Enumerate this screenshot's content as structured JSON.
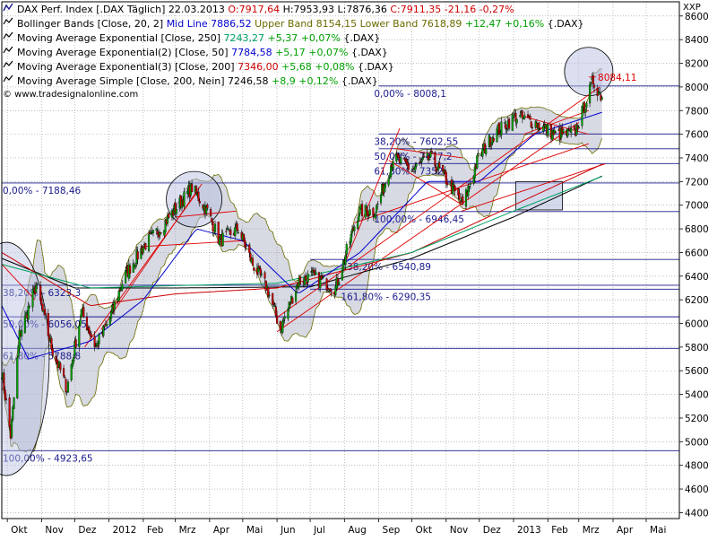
{
  "header": {
    "line1": {
      "instrument": "DAX Perf. Index [.DAX Täglich] 22.03.2013",
      "open": "O:7917,64",
      "high": "H:7953,93",
      "low": "L:7876,36",
      "close": "C:7911,35 -21,16 -0,27%"
    },
    "line2": {
      "prefix": "Bollinger Bands [Close, 20, 2]",
      "mid": "Mid Line 7886,52",
      "upper": "Upper Band 8154,15",
      "lower": "Lower Band 7618,89",
      "change": "+12,47 +0,16%",
      "suffix": "{.DAX}"
    },
    "line3": {
      "prefix": "Moving Average Exponential [Close, 250]",
      "value": "7243,27",
      "change": "+5,37 +0,07%",
      "suffix": "{.DAX}"
    },
    "line4": {
      "prefix": "Moving Average Exponential(2) [Close, 50]",
      "value": "7784,58",
      "change": "+5,17 +0,07%",
      "suffix": "{.DAX}"
    },
    "line5": {
      "prefix": "Moving Average Exponential(3) [Close, 200]",
      "value": "7346,00",
      "change": "+5,68 +0,08%",
      "suffix": "{.DAX}"
    },
    "line6": {
      "prefix": "Moving Average Simple [Close, 200, Nein]",
      "value": "7246,58",
      "change": "+8,9 +0,12%",
      "suffix": "{.DAX}"
    },
    "watermark": "© www.tradesignalonline.com"
  },
  "colors": {
    "upper_band": "#6b6b00",
    "lower_band": "#6b6b00",
    "ema250": "#00a060",
    "ema50": "#0000cc",
    "ema200": "#cc0000",
    "sma200": "#000000",
    "positive": "#00a000",
    "negative": "#cc0000",
    "fib_line": "#1a1a8c",
    "trend_line": "#e00000",
    "band_fill": "#c9ccda"
  },
  "chart_data": {
    "type": "candlestick",
    "axis_label": "XXP",
    "ylim": [
      4350,
      8720
    ],
    "y_ticks": [
      4400,
      4600,
      4800,
      5000,
      5200,
      5400,
      5600,
      5800,
      6000,
      6200,
      6400,
      6600,
      6800,
      7000,
      7200,
      7400,
      7600,
      7800,
      8000,
      8200,
      8400,
      8600
    ],
    "y_tick_labels": [
      "4400",
      "4600",
      "4800",
      "5000",
      "5200",
      "5400",
      "5600",
      "5800",
      "6000",
      "6200",
      "6400",
      "6600",
      "6800",
      "7000",
      "7200",
      "7400",
      "7600",
      "7800",
      "8000",
      "8200",
      "8400",
      "8600"
    ],
    "x_labels": [
      "Okt",
      "Nov",
      "Dez",
      "2012",
      "Feb",
      "Mrz",
      "Apr",
      "Mai",
      "Jun",
      "Jul",
      "Aug",
      "Sep",
      "Okt",
      "Nov",
      "Dez",
      "2013",
      "Feb",
      "Mrz",
      "Apr",
      "Mai"
    ],
    "x_range": [
      "2011-09-26",
      "2013-05-31"
    ],
    "x_label_dates": [
      "2011-10-01",
      "2011-11-01",
      "2011-12-01",
      "2012-01-01",
      "2012-02-01",
      "2012-03-01",
      "2012-04-01",
      "2012-05-01",
      "2012-06-01",
      "2012-07-01",
      "2012-08-01",
      "2012-09-01",
      "2012-10-01",
      "2012-11-01",
      "2012-12-01",
      "2013-01-01",
      "2013-02-01",
      "2013-03-01",
      "2013-04-01",
      "2013-05-01"
    ],
    "price_path": [
      {
        "date": "2011-09-26",
        "value": 5600
      },
      {
        "date": "2011-10-04",
        "value": 5050
      },
      {
        "date": "2011-10-12",
        "value": 5900
      },
      {
        "date": "2011-10-27",
        "value": 6320
      },
      {
        "date": "2011-11-10",
        "value": 5800
      },
      {
        "date": "2011-11-24",
        "value": 5450
      },
      {
        "date": "2011-12-07",
        "value": 6100
      },
      {
        "date": "2011-12-20",
        "value": 5800
      },
      {
        "date": "2012-01-02",
        "value": 6050
      },
      {
        "date": "2012-01-15",
        "value": 6400
      },
      {
        "date": "2012-02-01",
        "value": 6650
      },
      {
        "date": "2012-02-16",
        "value": 6800
      },
      {
        "date": "2012-03-16",
        "value": 7150
      },
      {
        "date": "2012-03-30",
        "value": 6950
      },
      {
        "date": "2012-04-10",
        "value": 6700
      },
      {
        "date": "2012-04-27",
        "value": 6800
      },
      {
        "date": "2012-05-10",
        "value": 6500
      },
      {
        "date": "2012-05-23",
        "value": 6300
      },
      {
        "date": "2012-06-04",
        "value": 5950
      },
      {
        "date": "2012-06-20",
        "value": 6350
      },
      {
        "date": "2012-07-02",
        "value": 6400
      },
      {
        "date": "2012-07-24",
        "value": 6300
      },
      {
        "date": "2012-08-14",
        "value": 6950
      },
      {
        "date": "2012-08-29",
        "value": 6950
      },
      {
        "date": "2012-09-14",
        "value": 7400
      },
      {
        "date": "2012-10-01",
        "value": 7300
      },
      {
        "date": "2012-10-18",
        "value": 7400
      },
      {
        "date": "2012-11-06",
        "value": 7150
      },
      {
        "date": "2012-11-16",
        "value": 7000
      },
      {
        "date": "2012-11-30",
        "value": 7400
      },
      {
        "date": "2012-12-14",
        "value": 7600
      },
      {
        "date": "2013-01-03",
        "value": 7750
      },
      {
        "date": "2013-01-20",
        "value": 7700
      },
      {
        "date": "2013-02-07",
        "value": 7600
      },
      {
        "date": "2013-02-25",
        "value": 7600
      },
      {
        "date": "2013-03-14",
        "value": 8050
      },
      {
        "date": "2013-03-22",
        "value": 7911
      }
    ],
    "sma200": [
      {
        "date": "2011-09-26",
        "value": 6550
      },
      {
        "date": "2011-12-01",
        "value": 6300
      },
      {
        "date": "2012-03-01",
        "value": 6300
      },
      {
        "date": "2012-07-01",
        "value": 6310
      },
      {
        "date": "2012-10-01",
        "value": 6550
      },
      {
        "date": "2013-01-01",
        "value": 6900
      },
      {
        "date": "2013-03-22",
        "value": 7247
      }
    ],
    "ema200": [
      {
        "date": "2011-09-26",
        "value": 6600
      },
      {
        "date": "2011-12-15",
        "value": 6150
      },
      {
        "date": "2012-03-01",
        "value": 6250
      },
      {
        "date": "2012-06-01",
        "value": 6300
      },
      {
        "date": "2012-10-01",
        "value": 6600
      },
      {
        "date": "2013-01-01",
        "value": 7000
      },
      {
        "date": "2013-03-22",
        "value": 7346
      }
    ],
    "ema250": [
      {
        "date": "2011-09-26",
        "value": 6500
      },
      {
        "date": "2011-12-15",
        "value": 6300
      },
      {
        "date": "2012-03-01",
        "value": 6320
      },
      {
        "date": "2012-06-01",
        "value": 6340
      },
      {
        "date": "2012-10-01",
        "value": 6600
      },
      {
        "date": "2013-01-01",
        "value": 6950
      },
      {
        "date": "2013-03-22",
        "value": 7243
      }
    ],
    "ema50": [
      {
        "date": "2011-09-26",
        "value": 6150
      },
      {
        "date": "2011-10-20",
        "value": 5700
      },
      {
        "date": "2011-12-15",
        "value": 5850
      },
      {
        "date": "2012-02-01",
        "value": 6200
      },
      {
        "date": "2012-03-20",
        "value": 6800
      },
      {
        "date": "2012-05-01",
        "value": 6700
      },
      {
        "date": "2012-06-20",
        "value": 6250
      },
      {
        "date": "2012-08-15",
        "value": 6600
      },
      {
        "date": "2012-10-15",
        "value": 7200
      },
      {
        "date": "2012-12-01",
        "value": 7200
      },
      {
        "date": "2013-01-20",
        "value": 7600
      },
      {
        "date": "2013-03-22",
        "value": 7785
      }
    ],
    "fib_levels": [
      {
        "label": "0,00% - 8008,1",
        "value": 8008,
        "from": "2012-09-01",
        "label_at": "2012-08-27"
      },
      {
        "label": "38,20% - 7602,55",
        "value": 7602,
        "from": "2012-09-01",
        "label_at": "2012-08-27"
      },
      {
        "label": "50,00% - 7477,2",
        "value": 7477,
        "from": "2012-09-01",
        "label_at": "2012-08-27"
      },
      {
        "label": "61,80% - 7352",
        "value": 7352,
        "from": "2012-09-01",
        "label_at": "2012-08-27"
      },
      {
        "label": "100,00% - 6946,45",
        "value": 6946,
        "from": "2012-09-01",
        "label_at": "2012-08-27"
      },
      {
        "label": "138,20% - 6540,89",
        "value": 6541,
        "from": "2012-07-01",
        "label_at": "2012-07-28"
      },
      {
        "label": "161,80% - 6290,35",
        "value": 6290,
        "from": "2012-07-01",
        "label_at": "2012-07-28"
      },
      {
        "label": "0,00% - 7188,46",
        "value": 7188,
        "from": "2011-09-26",
        "label_at": "2011-09-26"
      },
      {
        "label": "38,20% - 6323,3",
        "value": 6323,
        "from": "2011-09-26",
        "label_at": "2011-09-26"
      },
      {
        "label": "50,00% - 6056,05",
        "value": 6056,
        "from": "2011-09-26",
        "label_at": "2011-09-26"
      },
      {
        "label": "61,80% - 5788,8",
        "value": 5789,
        "from": "2011-09-26",
        "label_at": "2011-09-26"
      },
      {
        "label": "100,00% - 4923,65",
        "value": 4924,
        "from": "2011-09-26",
        "label_at": "2011-09-26"
      }
    ],
    "annotation": {
      "label": "8084,11",
      "date": "2013-03-15",
      "value": 8084
    },
    "grid": true,
    "legend": "top-left"
  }
}
